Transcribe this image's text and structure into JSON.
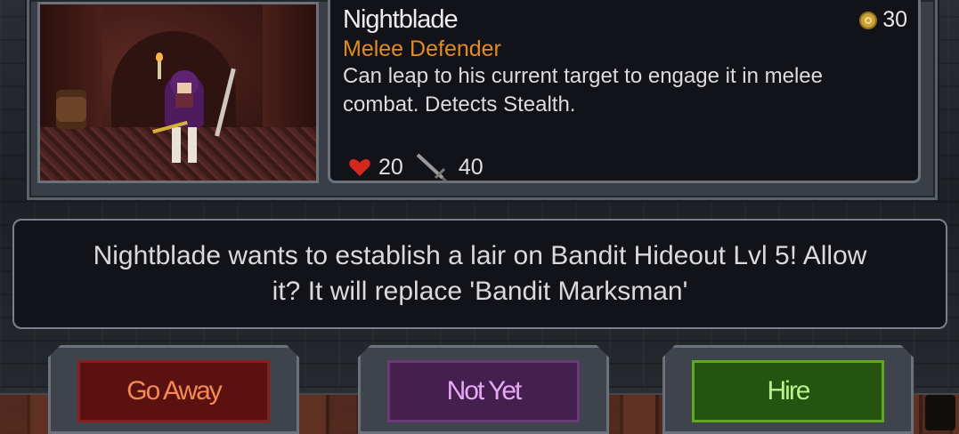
{
  "unit": {
    "name": "Nightblade",
    "role": "Melee Defender",
    "description": "Can leap to his current target to engage it in melee combat. Detects Stealth.",
    "cost": "30",
    "health": "20",
    "attack": "40"
  },
  "message": "Nightblade wants to establish a lair on Bandit Hideout Lvl 5! Allow it? It will replace 'Bandit Marksman'",
  "buttons": {
    "go_away": "Go Away",
    "not_yet": "Not Yet",
    "hire": "Hire"
  },
  "colors": {
    "role_text": "#e28a23",
    "go_away": "#5c1111",
    "not_yet": "#45204f",
    "hire": "#24540f"
  },
  "icons": {
    "cost": "gold-coin-icon",
    "health": "heart-icon",
    "attack": "sword-icon"
  }
}
